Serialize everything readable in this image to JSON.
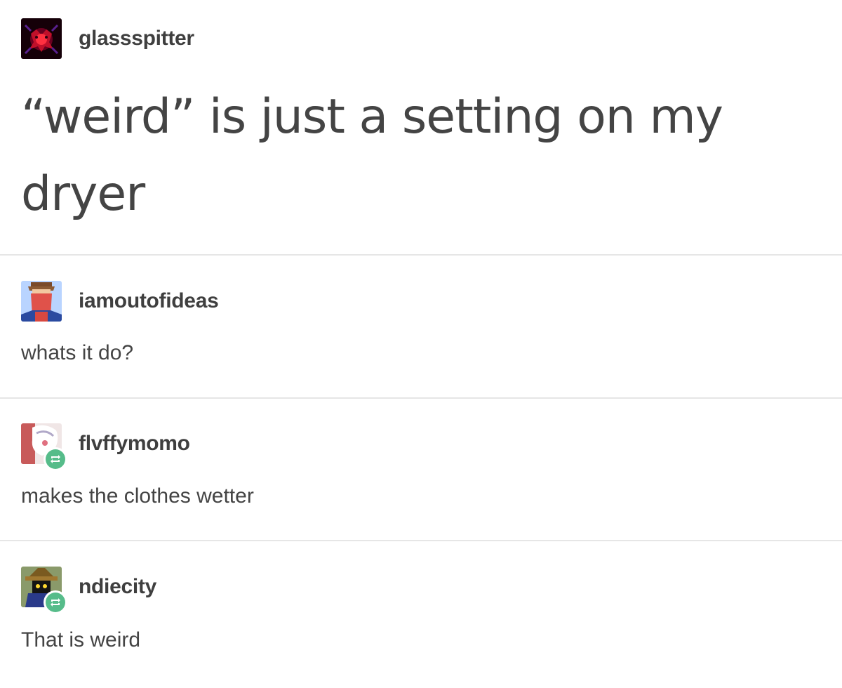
{
  "original_post": {
    "username": "glassspitter",
    "avatar_icon": "red-figure-avatar-icon",
    "text": "“weird” is just a setting on my dryer"
  },
  "replies": [
    {
      "username": "iamoutofideas",
      "avatar_icon": "red-mask-avatar-icon",
      "reblogged": false,
      "text": "whats it do?"
    },
    {
      "username": "flvffymomo",
      "avatar_icon": "anime-character-avatar-icon",
      "reblogged": true,
      "text": "makes the clothes wetter"
    },
    {
      "username": "ndiecity",
      "avatar_icon": "black-mage-avatar-icon",
      "reblogged": true,
      "text": "That is weird"
    }
  ],
  "colors": {
    "text": "#444444",
    "divider": "#e6e6e6",
    "reblog_badge": "#56bc8a"
  }
}
